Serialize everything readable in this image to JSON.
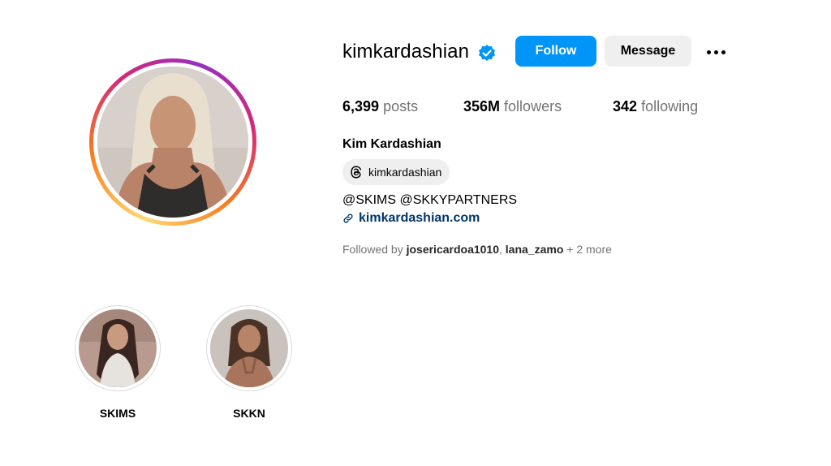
{
  "profile": {
    "username": "kimkardashian",
    "verified_icon": "verified-badge-icon",
    "full_name": "Kim Kardashian",
    "threads_handle": "kimkardashian",
    "bio": "@SKIMS @SKKYPARTNERS",
    "link": "kimkardashian.com",
    "avatar_ring_colors": [
      "#feda75",
      "#fa7e1e",
      "#d62976",
      "#962fbf"
    ]
  },
  "actions": {
    "follow": "Follow",
    "message": "Message",
    "more_icon": "more-options-icon"
  },
  "stats": {
    "posts_count": "6,399",
    "posts_label": "posts",
    "followers_count": "356M",
    "followers_label": "followers",
    "following_count": "342",
    "following_label": "following"
  },
  "followed_by": {
    "prefix": "Followed by",
    "user1": "josericardoa1010",
    "separator": ",",
    "user2": "lana_zamo",
    "more": "+ 2 more"
  },
  "highlights": [
    {
      "label": "SKIMS"
    },
    {
      "label": "SKKN"
    }
  ],
  "colors": {
    "primary_button": "#0095f6",
    "secondary_button": "#efefef",
    "link": "#00376b",
    "verified": "#0095f6",
    "muted_text": "#737373"
  }
}
